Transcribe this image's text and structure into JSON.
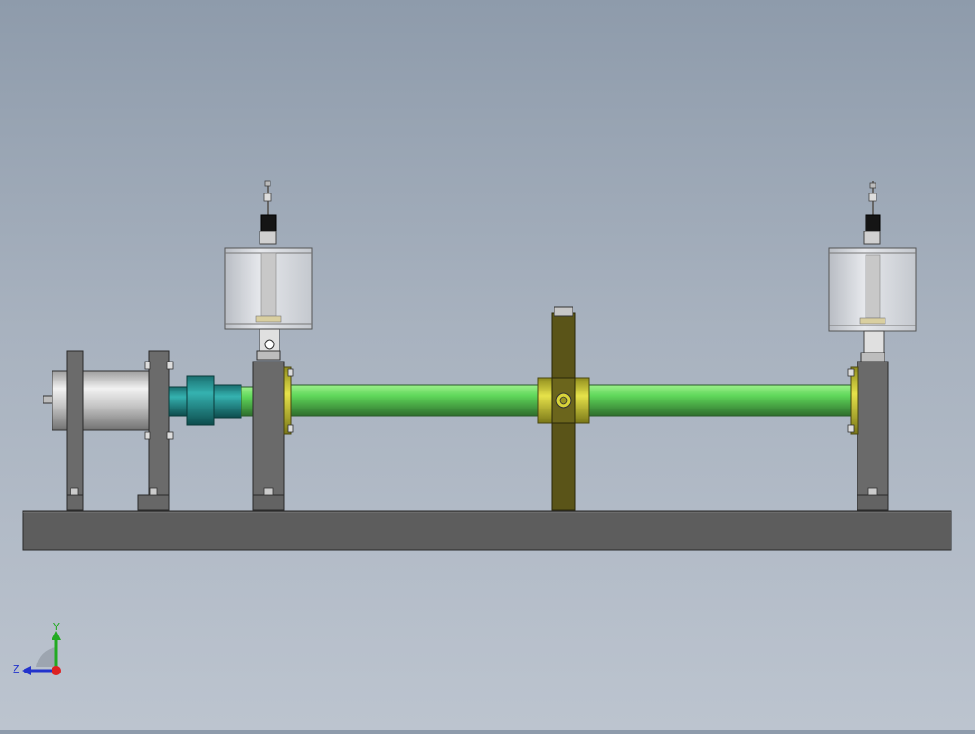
{
  "viewport": {
    "background_top": "#8e9bab",
    "background_bottom": "#bcc4cf"
  },
  "model": {
    "colors": {
      "base": "#5f5f5f",
      "plate": "#6e6e6e",
      "motor": "#c8c8c8",
      "coupling": "#1f8c8a",
      "shaft": "#6fd86a",
      "flange": "#d9d63a",
      "disk": "#5a5418",
      "oil_cup_glass": "#d6d9de"
    }
  },
  "triad": {
    "y_label": "Y",
    "z_label": "Z",
    "y_color": "#22aa22",
    "z_color": "#2233cc",
    "x_color": "#dd2222"
  }
}
